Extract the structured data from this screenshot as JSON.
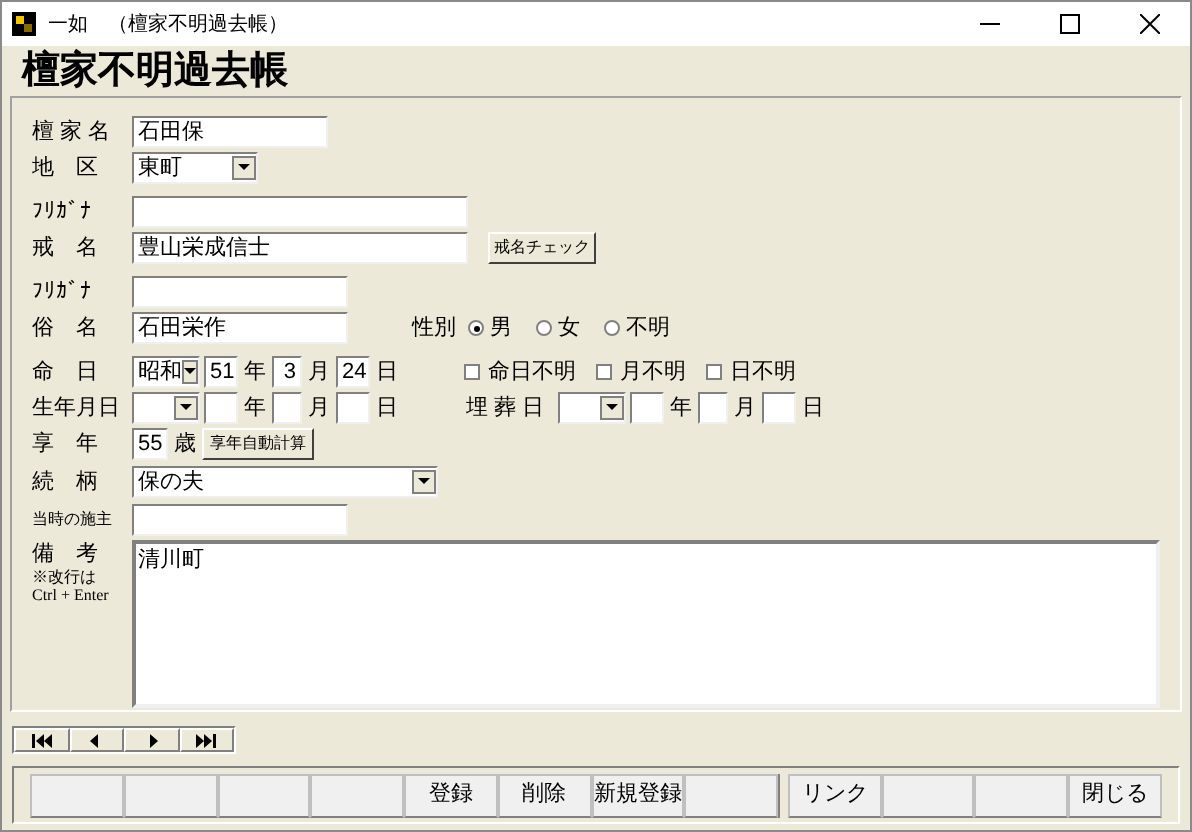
{
  "window": {
    "title": "一如　（檀家不明過去帳）"
  },
  "heading": "檀家不明過去帳",
  "danka_name": {
    "label": "檀 家 名",
    "value": "石田保"
  },
  "district": {
    "label": "地　区",
    "value": "東町"
  },
  "kaimyo_furigana": {
    "label": "ﾌﾘｶﾞﾅ"
  },
  "kaimyo": {
    "label": "戒　名",
    "value": "豊山栄成信士",
    "button": "戒名チェック"
  },
  "zokumyo_furigana": {
    "label": "ﾌﾘｶﾞﾅ"
  },
  "zokumyo": {
    "label": "俗　名",
    "value": "石田栄作"
  },
  "gender": {
    "label": "性別",
    "options": [
      {
        "label": "男",
        "selected": true
      },
      {
        "label": "女",
        "selected": false
      },
      {
        "label": "不明",
        "selected": false
      }
    ]
  },
  "death_date": {
    "label": "命　日",
    "era": "昭和",
    "year": "51",
    "year_unit": "年",
    "month": "3",
    "month_unit": "月",
    "day": "24",
    "day_unit": "日"
  },
  "unknown_flags": [
    {
      "label": "命日不明",
      "checked": false
    },
    {
      "label": "月不明",
      "checked": false
    },
    {
      "label": "日不明",
      "checked": false
    }
  ],
  "birth_date": {
    "label": "生年月日",
    "year_unit": "年",
    "month_unit": "月",
    "day_unit": "日"
  },
  "burial_date": {
    "label": "埋 葬 日",
    "year_unit": "年",
    "month_unit": "月",
    "day_unit": "日"
  },
  "age": {
    "label": "享　年",
    "value": "55",
    "unit": "歳",
    "button": "享年自動計算"
  },
  "relation": {
    "label": "続　柄",
    "value": "保の夫"
  },
  "chief_mourner": {
    "label": "当時の施主"
  },
  "remarks": {
    "label": "備　考",
    "note": "※改行は",
    "note2": "Ctrl + Enter",
    "value": "清川町"
  },
  "footer_buttons": [
    {
      "kind": "blank"
    },
    {
      "kind": "blank"
    },
    {
      "kind": "blank"
    },
    {
      "kind": "blank"
    },
    {
      "kind": "button",
      "label": "登録"
    },
    {
      "kind": "button",
      "label": "削除"
    },
    {
      "kind": "button",
      "label": "新規登録"
    },
    {
      "kind": "blank"
    },
    {
      "kind": "gap"
    },
    {
      "kind": "button",
      "label": "リンク"
    },
    {
      "kind": "blank"
    },
    {
      "kind": "blank"
    },
    {
      "kind": "button",
      "label": "閉じる"
    }
  ]
}
